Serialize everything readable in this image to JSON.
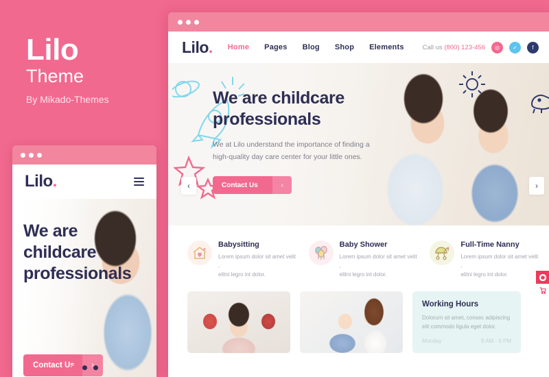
{
  "promo": {
    "title": "Lilo",
    "subtitle": "Theme",
    "author": "By Mikado-Themes",
    "bg_color": "#f2698f"
  },
  "browser": {
    "titlebar_color": "#f2869f",
    "logo": "Lilo",
    "logo_dot": ".",
    "menu": [
      {
        "label": "Home",
        "active": true
      },
      {
        "label": "Pages",
        "active": false
      },
      {
        "label": "Blog",
        "active": false
      },
      {
        "label": "Shop",
        "active": false
      },
      {
        "label": "Elements",
        "active": false
      }
    ],
    "call_label": "Call us",
    "phone": "(800) 123-456",
    "social": [
      {
        "name": "instagram-icon",
        "glyph": "◎",
        "color": "#f2698f"
      },
      {
        "name": "twitter-icon",
        "glyph": "✓",
        "color": "#5ec3ef"
      },
      {
        "name": "facebook-icon",
        "glyph": "f",
        "color": "#2e3a6e"
      }
    ]
  },
  "hero": {
    "heading": "We are childcare\nprofessionals",
    "paragraph": "We at Lilo understand the importance of finding a\nhigh-quality day care center for your little ones.",
    "cta_label": "Contact Us",
    "cta_arrow": "›",
    "prev_arrow": "‹",
    "next_arrow": "›",
    "heading_color": "#2e2e55",
    "accent_color": "#f2698f"
  },
  "services": [
    {
      "icon": "house-heart-icon",
      "title": "Babysitting",
      "desc": "Lorem ipsum dolor sit amet velit ,\nelitni legro int dolor.",
      "circle_color": "#fdf1ec"
    },
    {
      "icon": "balloons-icon",
      "title": "Baby Shower",
      "desc": "Lorem ipsum dolor sit amet velit ,\nelitni legro int dolor.",
      "circle_color": "#fdeef1"
    },
    {
      "icon": "stroller-icon",
      "title": "Full-Time Nanny",
      "desc": "Lorem ipsum dolor sit amet velit ,\nelitni legro int dolor.",
      "circle_color": "#f4f5e2"
    }
  ],
  "gallery": [
    {
      "name": "child-painted-hands-photo"
    },
    {
      "name": "mother-and-baby-photo"
    }
  ],
  "working_hours": {
    "title": "Working Hours",
    "desc": "Dolorum sit amet, consec adipiscing\nelit commodo ligula eget dolor.",
    "rows": [
      {
        "day": "Monday",
        "time": "9 AM - 5 PM"
      }
    ],
    "bg_color": "#e6f4f3"
  },
  "mobile": {
    "titlebar_color": "#f2869f",
    "logo": "Lilo",
    "logo_dot": ".",
    "menu_icon": "hamburger-icon",
    "heading": "We are\nchildcare\nprofessionals",
    "cta_label": "Contact Us",
    "cta_arrow": "›",
    "slider_dots": 3,
    "active_dot": 0
  },
  "rail": [
    {
      "name": "color-picker-widget",
      "glyph": "◉"
    },
    {
      "name": "cart-widget",
      "glyph": "Ὥ2"
    }
  ]
}
